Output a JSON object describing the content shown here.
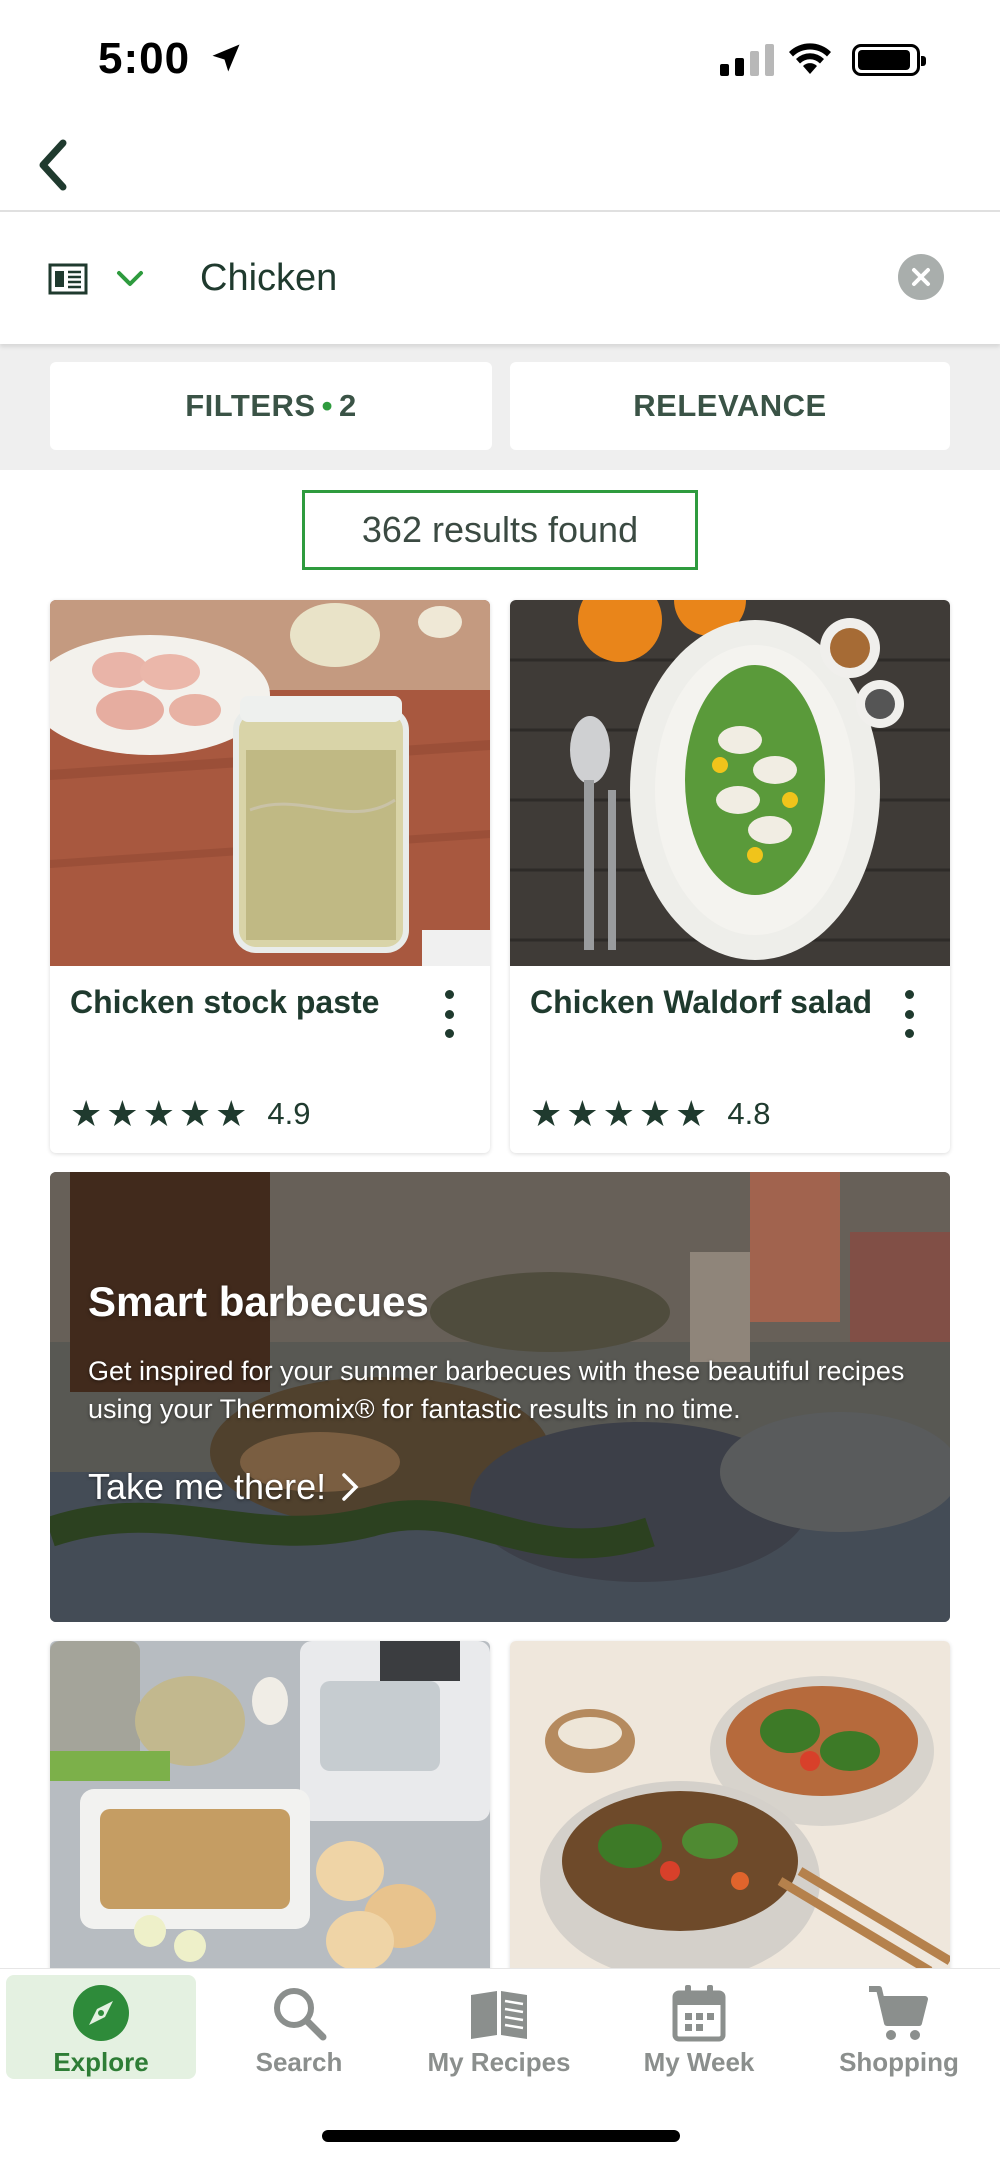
{
  "status_bar": {
    "time": "5:00"
  },
  "search": {
    "query": "Chicken"
  },
  "filters": {
    "filters_label": "FILTERS",
    "filters_separator": "•",
    "filters_count": "2",
    "sort_label": "RELEVANCE"
  },
  "results": {
    "count_text": "362 results found"
  },
  "recipes": [
    {
      "title": "Chicken stock paste",
      "rating": "4.9"
    },
    {
      "title": "Chicken Waldorf salad",
      "rating": "4.8"
    }
  ],
  "banner": {
    "title": "Smart barbecues",
    "description": "Get inspired for your summer barbecues with these beautiful recipes using your Thermomix® for fantastic results in no time.",
    "cta": "Take me there!"
  },
  "tab_bar": {
    "items": [
      {
        "label": "Explore",
        "icon": "compass-icon",
        "active": true
      },
      {
        "label": "Search",
        "icon": "search-icon",
        "active": false
      },
      {
        "label": "My Recipes",
        "icon": "book-icon",
        "active": false
      },
      {
        "label": "My Week",
        "icon": "calendar-icon",
        "active": false
      },
      {
        "label": "Shopping",
        "icon": "cart-icon",
        "active": false
      }
    ]
  },
  "colors": {
    "accent_green": "#2e9b3e",
    "text_dark_green": "#1f3a2e",
    "active_tab_bg": "#e4f1e1"
  }
}
